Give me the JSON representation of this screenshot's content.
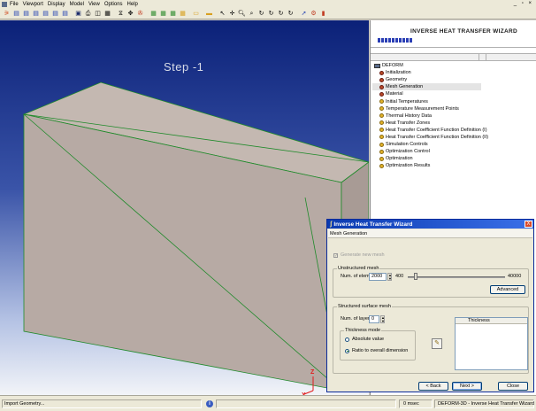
{
  "menubar": {
    "items": [
      "File",
      "Viewport",
      "Display",
      "Model",
      "View",
      "Options",
      "Help"
    ],
    "window_controls": "_ ▫ ×"
  },
  "toolbar": {
    "icons": [
      "layout-icon",
      "layout-icon",
      "layout-icon",
      "layout-icon",
      "layout-icon",
      "layout-icon",
      "layout-icon",
      "save-icon",
      "print-icon",
      "screenshot-icon",
      "export-icon",
      "mesh-icon",
      "move-icon",
      "rotate-icon",
      "table-icon",
      "table-icon",
      "table-icon",
      "table-icon",
      "open-icon",
      "window-icon",
      "select-icon",
      "pan-icon",
      "zoom-icon",
      "zoom-box-icon",
      "rotate-x-icon",
      "rotate-y-icon",
      "rotate-z-icon",
      "rotate-free-icon",
      "help-icon",
      "settings-icon",
      "exit-icon"
    ]
  },
  "viewport": {
    "step_label": "Step  -1",
    "axis_z": "Z",
    "axis_x": "X",
    "background_top": "#0b2178",
    "model_color": "#b7aaa4",
    "edge_color": "#1f8a2a"
  },
  "wizard_panel": {
    "title": "INVERSE HEAT TRANSFER WIZARD",
    "progress_segments": 10,
    "tree": {
      "root": "DEFORM",
      "items": [
        {
          "label": "Initialization",
          "state": "done"
        },
        {
          "label": "Geometry",
          "state": "done"
        },
        {
          "label": "Mesh Generation",
          "state": "done",
          "selected": true
        },
        {
          "label": "Material",
          "state": "done"
        },
        {
          "label": "Initial Temperatures",
          "state": "pending"
        },
        {
          "label": "Temperature Measurement Points",
          "state": "pending"
        },
        {
          "label": "Thermal History Data",
          "state": "pending"
        },
        {
          "label": "Heat Transfer Zones",
          "state": "pending"
        },
        {
          "label": "Heat Transfer Coefficient Function Definition (I)",
          "state": "pending"
        },
        {
          "label": "Heat Transfer Coefficient Function Definition (II)",
          "state": "pending"
        },
        {
          "label": "Simulation Controls",
          "state": "pending"
        },
        {
          "label": "Optimization Control",
          "state": "pending"
        },
        {
          "label": "Optimization",
          "state": "pending"
        },
        {
          "label": "Optimization Results",
          "state": "pending"
        }
      ]
    }
  },
  "dialog": {
    "title": "Inverse Heat Transfer Wizard",
    "close": "X",
    "subtitle": "Mesh Generation",
    "generate_new_mesh": {
      "label": "Generate new mesh",
      "checked": true,
      "disabled": true
    },
    "unstructured": {
      "label": "Unstructured mesh",
      "num_elems_label": "Num. of elem.",
      "num_elems_value": "2000",
      "min": "400",
      "max": "40000",
      "advanced_button": "Advanced"
    },
    "structured": {
      "label": "Structured surface mesh",
      "num_layers_label": "Num. of layers",
      "num_layers_value": "0",
      "thickness_mode_label": "Thickness mode",
      "absolute_label": "Absolute value",
      "ratio_label": "Ratio to overall dimension",
      "selected_mode": "ratio",
      "thickness_header": "Thickness"
    },
    "buttons": {
      "back": "< Back",
      "next": "Next >",
      "close": "Close"
    }
  },
  "statusbar": {
    "message": "Import Geometry...",
    "info": "i",
    "time": "0 msec",
    "app": "DEFORM-3D - Inverse Heat Transfer Wizard"
  }
}
